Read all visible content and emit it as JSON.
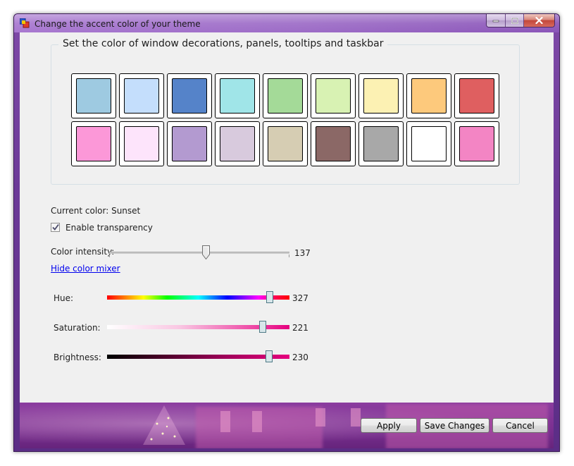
{
  "window": {
    "title": "Change the accent color of your theme"
  },
  "group": {
    "title": "Set the color of window decorations, panels, tooltips and taskbar"
  },
  "swatches": [
    {
      "color": "#9ecae1"
    },
    {
      "color": "#c4defc"
    },
    {
      "color": "#5583c9"
    },
    {
      "color": "#a0e5e8"
    },
    {
      "color": "#a4da98"
    },
    {
      "color": "#d8f2b3"
    },
    {
      "color": "#fcf1b3"
    },
    {
      "color": "#fdc97c"
    },
    {
      "color": "#df5f60"
    },
    {
      "color": "#fc98d8"
    },
    {
      "color": "#fde4fb"
    },
    {
      "color": "#b39ad0"
    },
    {
      "color": "#d8cadd"
    },
    {
      "color": "#d6cdb3"
    },
    {
      "color": "#8b6866"
    },
    {
      "color": "#a8a8a8"
    },
    {
      "color": "#ffffff"
    },
    {
      "color": "#f385c4"
    }
  ],
  "current_color": {
    "text": "Current color: Sunset"
  },
  "transparency": {
    "label": "Enable transparency",
    "checked": true
  },
  "intensity": {
    "label": "Color intensity:",
    "value": "137",
    "level": 137,
    "max": 255
  },
  "mixer_link": "Hide color mixer",
  "mixer": {
    "hue": {
      "label": "Hue:",
      "value": "327",
      "level": 327,
      "max": 360
    },
    "saturation": {
      "label": "Saturation:",
      "value": "221",
      "level": 221,
      "max": 255
    },
    "brightness": {
      "label": "Brightness:",
      "value": "230",
      "level": 230,
      "max": 255
    }
  },
  "buttons": {
    "apply": "Apply",
    "save": "Save Changes",
    "cancel": "Cancel"
  },
  "colors": {
    "accent_pink": "#e6007e",
    "titlebar": "#9c6bc6",
    "link": "#0000ee"
  }
}
